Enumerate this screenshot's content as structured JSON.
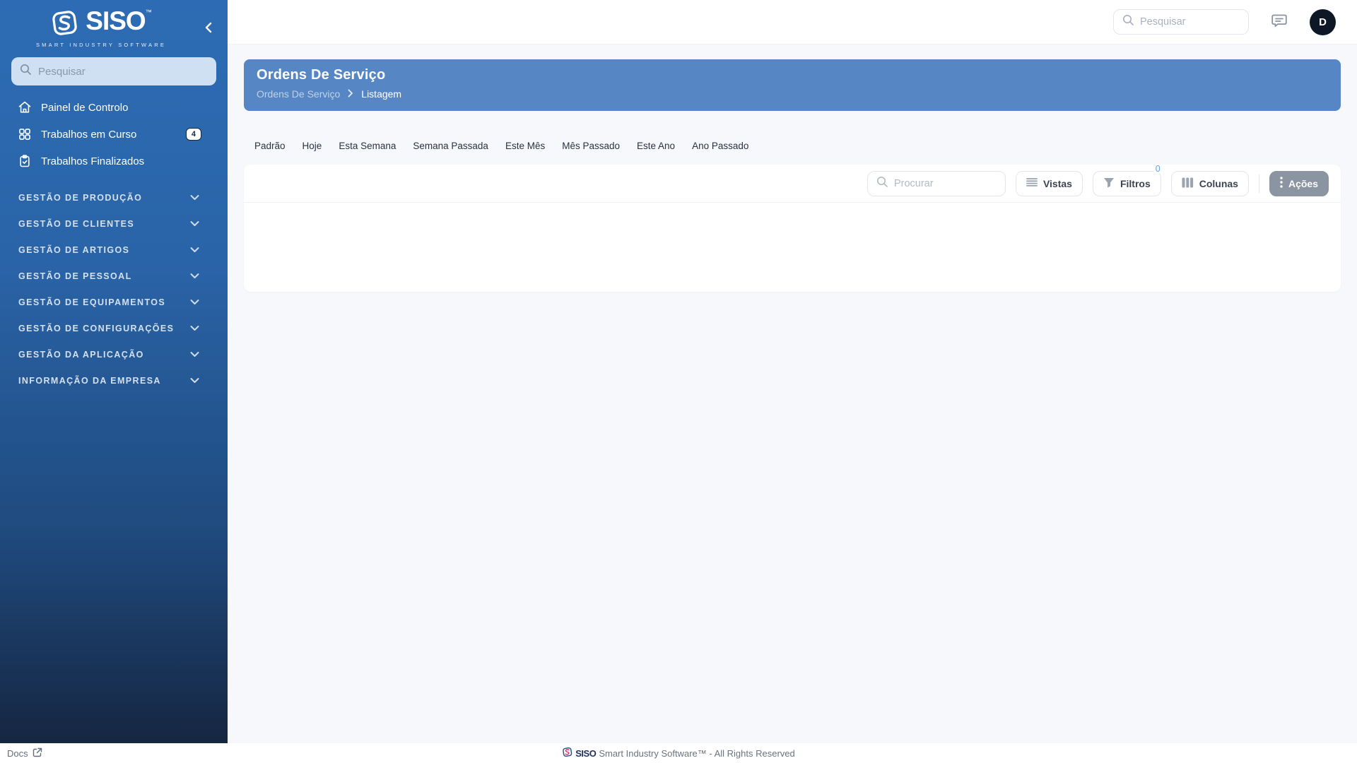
{
  "sidebar": {
    "logo": {
      "title": "SISO",
      "tm": "™",
      "subtitle": "SMART INDUSTRY SOFTWARE"
    },
    "search_placeholder": "Pesquisar",
    "nav": [
      {
        "label": "Painel de Controlo",
        "icon": "home-icon"
      },
      {
        "label": "Trabalhos em Curso",
        "icon": "grid-icon",
        "badge": "4"
      },
      {
        "label": "Trabalhos Finalizados",
        "icon": "clipboard-check-icon"
      }
    ],
    "sections": [
      "GESTÃO DE PRODUÇÃO",
      "GESTÃO DE CLIENTES",
      "GESTÃO DE ARTIGOS",
      "GESTÃO DE PESSOAL",
      "GESTÃO DE EQUIPAMENTOS",
      "GESTÃO DE CONFIGURAÇÕES",
      "GESTÃO DA APLICAÇÃO",
      "INFORMAÇÃO DA EMPRESA"
    ]
  },
  "topbar": {
    "search_placeholder": "Pesquisar",
    "avatar_initial": "D"
  },
  "banner": {
    "title": "Ordens De Serviço",
    "breadcrumb_parent": "Ordens De Serviço",
    "breadcrumb_current": "Listagem"
  },
  "filter_tabs": [
    "Padrão",
    "Hoje",
    "Esta Semana",
    "Semana Passada",
    "Este Mês",
    "Mês Passado",
    "Este Ano",
    "Ano Passado"
  ],
  "toolbar": {
    "search_placeholder": "Procurar",
    "vistas_label": "Vistas",
    "filtros_label": "Filtros",
    "filtros_badge": "0",
    "colunas_label": "Colunas",
    "acoes_label": "Ações"
  },
  "footer": {
    "docs_label": "Docs",
    "brand": "SISO",
    "copyright": "Smart Industry Software™ - All Rights Reserved"
  },
  "colors": {
    "sidebar_top": "#2d6cb4",
    "sidebar_bottom": "#152641",
    "banner_blue": "#5687c4",
    "acoes_gray": "#8b94a1",
    "badge_blue": "#64a2e3",
    "page_bg": "#f7f8fb"
  }
}
